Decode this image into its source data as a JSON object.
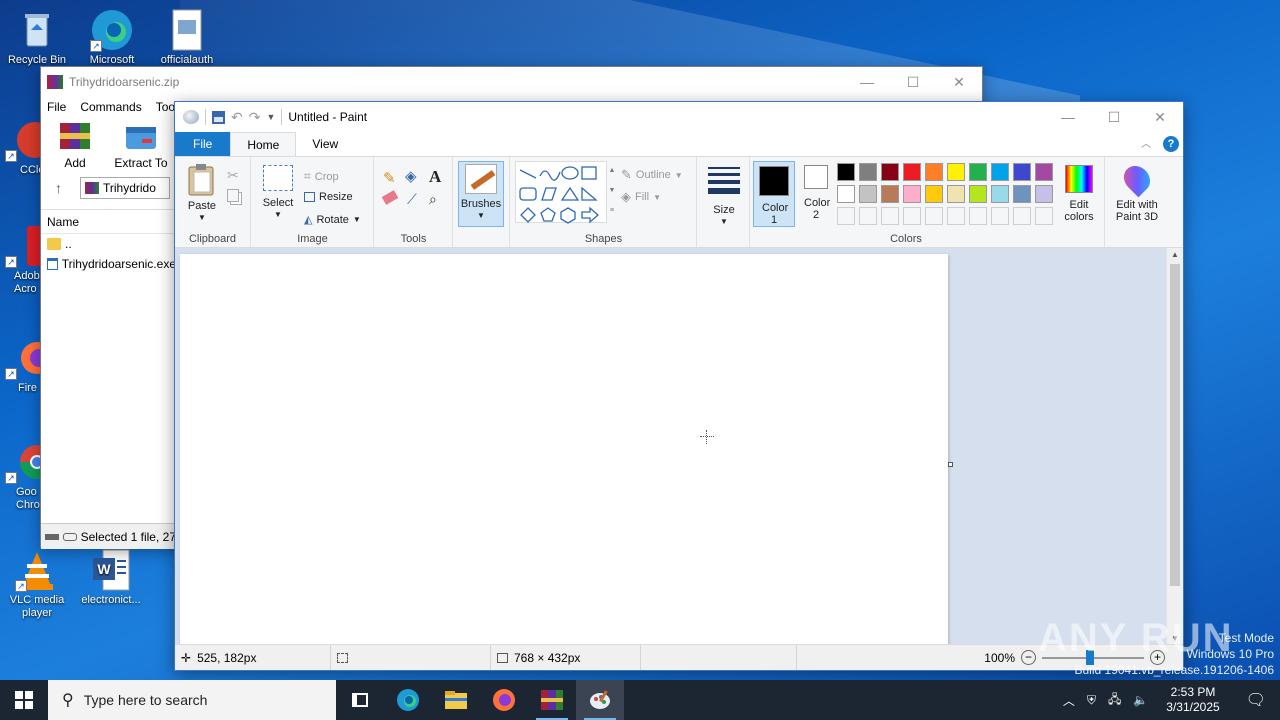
{
  "desktop": {
    "icons": [
      {
        "label": "Recycle Bin",
        "icon": "recycle-bin-icon"
      },
      {
        "label": "Microsoft",
        "icon": "edge-icon"
      },
      {
        "label": "officialauth",
        "icon": "file-icon"
      },
      {
        "label": "CCle",
        "icon": "ccleaner-icon"
      },
      {
        "label": "Adob Acro",
        "icon": "acrobat-icon"
      },
      {
        "label": "Fire",
        "icon": "firefox-icon"
      },
      {
        "label": "Goo Chro",
        "icon": "chrome-icon"
      },
      {
        "label": "VLC media player",
        "icon": "vlc-icon"
      },
      {
        "label": "electronict...",
        "icon": "word-icon"
      }
    ]
  },
  "winrar": {
    "title": "Trihydridoarsenic.zip",
    "menu": [
      "File",
      "Commands",
      "Too"
    ],
    "tools": [
      {
        "label": "Add"
      },
      {
        "label": "Extract To"
      }
    ],
    "path": "Trihydrido",
    "list_header": "Name",
    "rows": [
      {
        "name": "..",
        "icon": "folder-icon"
      },
      {
        "name": "Trihydridoarsenic.exe",
        "icon": "exe-icon"
      }
    ],
    "status": "Selected 1 file, 27"
  },
  "paint": {
    "title": "Untitled - Paint",
    "tabs": {
      "file": "File",
      "home": "Home",
      "view": "View"
    },
    "clipboard": {
      "paste": "Paste",
      "group": "Clipboard"
    },
    "image": {
      "select": "Select",
      "crop": "Crop",
      "resize": "Resize",
      "rotate": "Rotate",
      "group": "Image"
    },
    "tools": {
      "group": "Tools"
    },
    "brushes": {
      "label": "Brushes"
    },
    "shapes": {
      "outline": "Outline",
      "fill": "Fill",
      "group": "Shapes"
    },
    "size": {
      "label": "Size"
    },
    "colors": {
      "color1": "Color 1",
      "color2": "Color 2",
      "edit": "Edit colors",
      "paint3d": "Edit with Paint 3D",
      "group": "Colors",
      "color1_value": "#000000",
      "color2_value": "#ffffff",
      "row1": [
        "#000000",
        "#7f7f7f",
        "#880015",
        "#ed1c24",
        "#ff7f27",
        "#fff200",
        "#22b14c",
        "#00a2e8",
        "#3f48cc",
        "#a349a4"
      ],
      "row2": [
        "#ffffff",
        "#c3c3c3",
        "#b97a57",
        "#ffaec9",
        "#ffc90e",
        "#efe4b0",
        "#b5e61d",
        "#99d9ea",
        "#7092be",
        "#c8bfe7"
      ],
      "row3": [
        "#f5f6f7",
        "#f5f6f7",
        "#f5f6f7",
        "#f5f6f7",
        "#f5f6f7",
        "#f5f6f7",
        "#f5f6f7",
        "#f5f6f7",
        "#f5f6f7",
        "#f5f6f7"
      ]
    },
    "status": {
      "cursor": "525, 182px",
      "canvas_size": "768 × 432px",
      "zoom": "100%"
    }
  },
  "taskbar": {
    "search_placeholder": "Type here to search",
    "time": "2:53 PM",
    "date": "3/31/2025"
  },
  "watermark": {
    "brand": "ANY RUN",
    "line1": "Test Mode",
    "line2": "Windows 10 Pro",
    "line3": "Build 19041.vb_release.191206-1406"
  }
}
